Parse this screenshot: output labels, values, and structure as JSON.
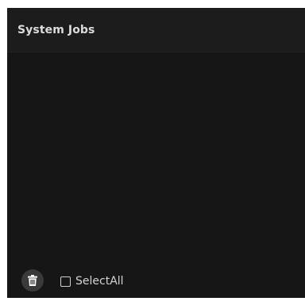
{
  "panel": {
    "title": "System Jobs"
  },
  "jobs": [],
  "footer": {
    "delete_icon": "trash-icon",
    "select_all_label": "SelectAll",
    "select_all_checked": false
  },
  "colors": {
    "panel_bg": "#161616",
    "header_bg": "#1c1c1c",
    "icon_button_bg": "#3a3a3a",
    "text": "#dcdcdc"
  }
}
